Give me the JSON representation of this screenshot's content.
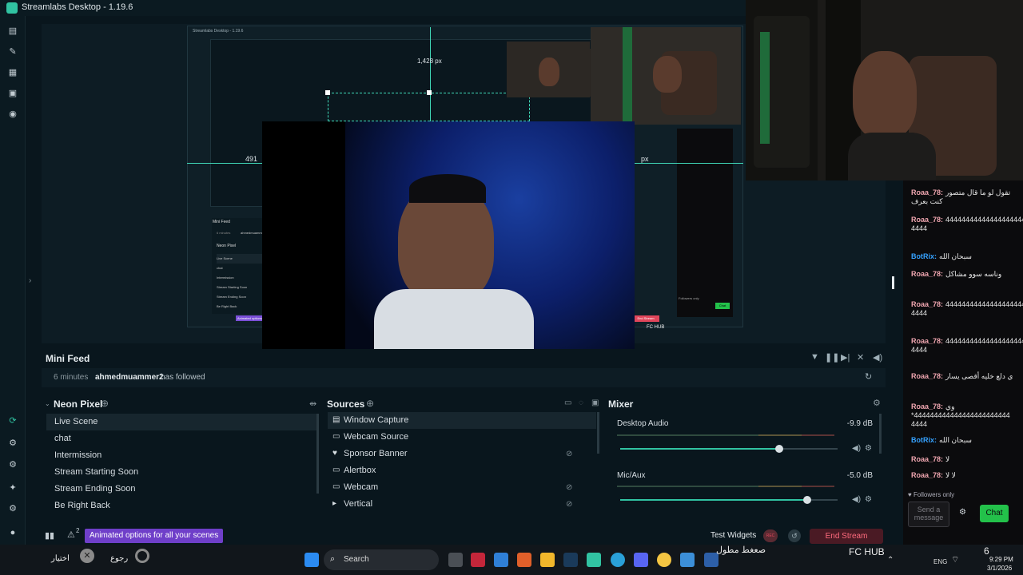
{
  "window": {
    "title": "Streamlabs Desktop - 1.19.6"
  },
  "preview": {
    "nested_title": "Streamlabs Desktop - 1.19.6",
    "guide_left_value": "491",
    "guide_right_suffix": "px",
    "guide_top_value": "1,428 px",
    "nested_mini_feed": "Mini Feed",
    "nested_feed_time": "6 minutes",
    "nested_feed_user": "ahmedmuammer2",
    "nested_collection": "Neon Pixel",
    "nested_scenes": [
      "Live Scene",
      "chat",
      "Intermission",
      "Stream Starting Soon",
      "Stream Ending Soon",
      "Be Right Back"
    ],
    "nested_end_stream": "End Stream",
    "nested_animated": "Animated options",
    "nested_taskbar_label": "FC HUB",
    "nested_chat_button": "Chat",
    "nested_followers": "Followers only"
  },
  "mini_feed": {
    "title": "Mini Feed",
    "time": "6 minutes",
    "user": "ahmedmuammer2",
    "action": "has followed"
  },
  "scenes": {
    "collection": "Neon Pixel",
    "items": [
      "Live Scene",
      "chat",
      "Intermission",
      "Stream Starting Soon",
      "Stream Ending Soon",
      "Be Right Back"
    ],
    "selected_index": 0
  },
  "sources": {
    "title": "Sources",
    "items": [
      {
        "name": "Window Capture",
        "icon": "window-icon",
        "hidden": false
      },
      {
        "name": "Webcam Source",
        "icon": "camera-icon",
        "hidden": false
      },
      {
        "name": "Sponsor Banner",
        "icon": "heart-icon",
        "hidden": true
      },
      {
        "name": "Alertbox",
        "icon": "bell-icon",
        "hidden": false
      },
      {
        "name": "Webcam",
        "icon": "camera-icon",
        "hidden": true
      },
      {
        "name": "Vertical",
        "icon": "folder-icon",
        "hidden": true
      }
    ],
    "selected_index": 0
  },
  "mixer": {
    "title": "Mixer",
    "channels": [
      {
        "name": "Desktop Audio",
        "db": "-9.9 dB",
        "level": 0.73
      },
      {
        "name": "Mic/Aux",
        "db": "-5.0 dB",
        "level": 0.86
      }
    ]
  },
  "footer": {
    "badge_count": "2",
    "animated_options": "Animated options for all your scenes",
    "test_widgets": "Test Widgets",
    "rec": "REC",
    "end_stream": "End Stream"
  },
  "chat": {
    "messages": [
      {
        "user": "Roaa_78:",
        "text": "تقول لو ما قال متصور كنت بعرف",
        "bot": false
      },
      {
        "user": "Roaa_78:",
        "text": "444444444444444444444444* 4444",
        "bot": false
      },
      {
        "user": "BotRix:",
        "text": "سبحان الله",
        "bot": true
      },
      {
        "user": "Roaa_78:",
        "text": "وناسه سوو مشاكل",
        "bot": false
      },
      {
        "user": "Roaa_78:",
        "text": "444444444444444444444444* 4444",
        "bot": false
      },
      {
        "user": "Roaa_78:",
        "text": "444444444444444444444444* 4444",
        "bot": false
      },
      {
        "user": "Roaa_78:",
        "text": "ي دلع خليه أقصى يسار",
        "bot": false
      },
      {
        "user": "Roaa_78:",
        "text": "وي 444444444444444444444444* 4444",
        "bot": false
      },
      {
        "user": "BotRix:",
        "text": "سبحان الله",
        "bot": true
      },
      {
        "user": "Roaa_78:",
        "text": "لا",
        "bot": false
      },
      {
        "user": "Roaa_78:",
        "text": "لا لا",
        "bot": false
      }
    ],
    "followers_only": "Followers only",
    "input_placeholder": "Send a message",
    "chat_button": "Chat"
  },
  "taskbar": {
    "search_placeholder": "Search",
    "lang": "ENG",
    "time": "9:29 PM",
    "date": "3/1/2026",
    "obs_label_1": "اختيار",
    "obs_label_2": "رجوع",
    "tray_label": "FC HUB",
    "tray_arabic": "صعغط مطول",
    "tray_count": "6"
  },
  "colors": {
    "accent": "#31c3a2",
    "danger": "#e0465b",
    "twitch_purple": "#7a4fd8"
  }
}
